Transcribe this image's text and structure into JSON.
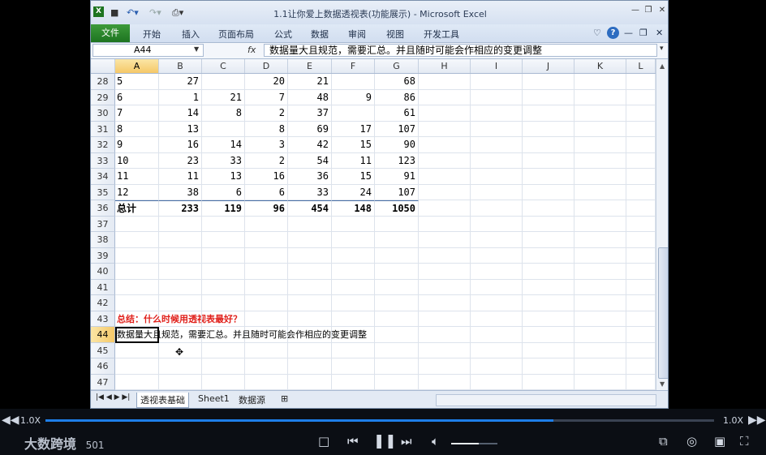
{
  "window": {
    "title": "1.1让你爱上数据透视表(功能展示) - Microsoft Excel",
    "quick_access": [
      "save-icon",
      "undo-icon",
      "redo-icon",
      "print-preview-icon"
    ]
  },
  "ribbon": {
    "file_tab": "文件",
    "tabs": [
      "开始",
      "插入",
      "页面布局",
      "公式",
      "数据",
      "审阅",
      "视图",
      "开发工具"
    ]
  },
  "formula_bar": {
    "name_box": "A44",
    "fx": "fx",
    "content": "数据量大且规范，需要汇总。并且随时可能会作相应的变更调整"
  },
  "columns": [
    "A",
    "B",
    "C",
    "D",
    "E",
    "F",
    "G",
    "H",
    "I",
    "J",
    "K",
    "L"
  ],
  "rows": [
    {
      "n": "28",
      "a": "5",
      "b": "27",
      "c": "",
      "d": "20",
      "e": "21",
      "f": "",
      "g": "68"
    },
    {
      "n": "29",
      "a": "6",
      "b": "1",
      "c": "21",
      "d": "7",
      "e": "48",
      "f": "9",
      "g": "86"
    },
    {
      "n": "30",
      "a": "7",
      "b": "14",
      "c": "8",
      "d": "2",
      "e": "37",
      "f": "",
      "g": "61"
    },
    {
      "n": "31",
      "a": "8",
      "b": "13",
      "c": "",
      "d": "8",
      "e": "69",
      "f": "17",
      "g": "107"
    },
    {
      "n": "32",
      "a": "9",
      "b": "16",
      "c": "14",
      "d": "3",
      "e": "42",
      "f": "15",
      "g": "90"
    },
    {
      "n": "33",
      "a": "10",
      "b": "23",
      "c": "33",
      "d": "2",
      "e": "54",
      "f": "11",
      "g": "123"
    },
    {
      "n": "34",
      "a": "11",
      "b": "11",
      "c": "13",
      "d": "16",
      "e": "36",
      "f": "15",
      "g": "91"
    },
    {
      "n": "35",
      "a": "12",
      "b": "38",
      "c": "6",
      "d": "6",
      "e": "33",
      "f": "24",
      "g": "107"
    },
    {
      "n": "36",
      "a": "总计",
      "b": "233",
      "c": "119",
      "d": "96",
      "e": "454",
      "f": "148",
      "g": "1050"
    }
  ],
  "empty_rows": [
    "37",
    "38",
    "39",
    "40",
    "41",
    "42"
  ],
  "row43": {
    "n": "43",
    "text": "总结：什么时候用透视表最好？",
    "color": "#e0201b"
  },
  "row44": {
    "n": "44",
    "text": "数据量大且规范，需要汇总。并且随时可能会作相应的变更调整"
  },
  "tail_rows": [
    "45",
    "46",
    "47"
  ],
  "sheet_tabs": [
    "透视表基础",
    "Sheet1",
    "数据源"
  ],
  "player": {
    "speed_left": "1.0X",
    "speed_right": "1.0X",
    "progress": 0.76,
    "volume": 0.6,
    "watermark": "大数跨境",
    "id_text": "501"
  }
}
